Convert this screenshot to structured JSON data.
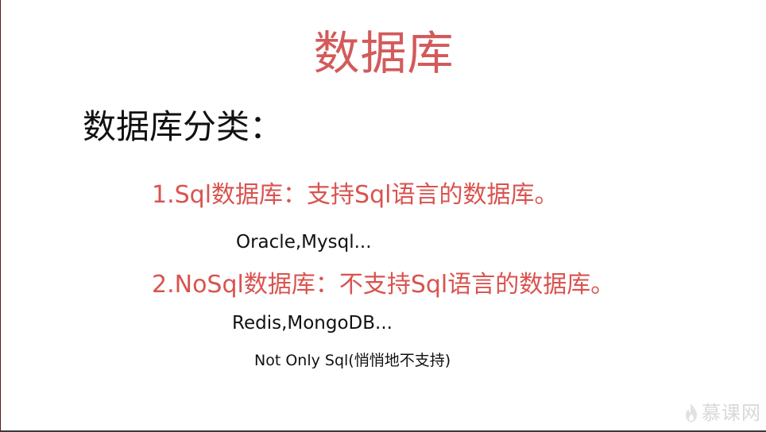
{
  "slide": {
    "title": "数据库",
    "subtitle": "数据库分类：",
    "items": [
      {
        "heading": "1.Sql数据库：支持Sql语言的数据库。",
        "examples": "Oracle,Mysql..."
      },
      {
        "heading": "2.NoSql数据库：不支持Sql语言的数据库。",
        "examples": "Redis,MongoDB...",
        "note": "Not Only Sql(悄悄地不支持)"
      }
    ]
  },
  "watermark": {
    "text": "慕课网",
    "icon": "flame-icon"
  },
  "colors": {
    "accent": "#d9534f",
    "text": "#111111",
    "background": "#ffffff"
  }
}
